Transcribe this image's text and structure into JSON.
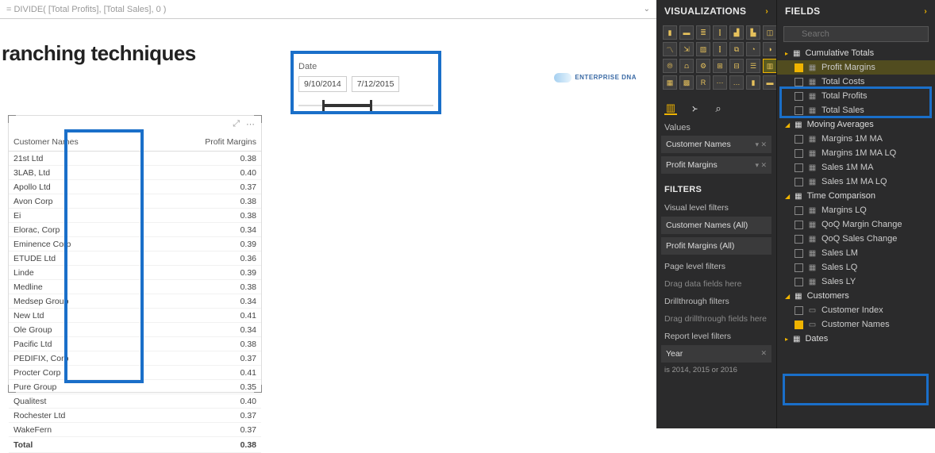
{
  "formula": "= DIVIDE( [Total Profits], [Total Sales], 0 )",
  "report_title": "ranching techniques",
  "date_slicer": {
    "label": "Date",
    "from": "9/10/2014",
    "to": "7/12/2015"
  },
  "logo_text": "ENTERPRISE DNA",
  "table": {
    "headers": [
      "Customer Names",
      "Profit Margins"
    ],
    "rows": [
      [
        "21st Ltd",
        "0.38"
      ],
      [
        "3LAB, Ltd",
        "0.40"
      ],
      [
        "Apollo Ltd",
        "0.37"
      ],
      [
        "Avon Corp",
        "0.38"
      ],
      [
        "Ei",
        "0.38"
      ],
      [
        "Elorac, Corp",
        "0.34"
      ],
      [
        "Eminence Corp",
        "0.39"
      ],
      [
        "ETUDE Ltd",
        "0.36"
      ],
      [
        "Linde",
        "0.39"
      ],
      [
        "Medline",
        "0.38"
      ],
      [
        "Medsep Group",
        "0.34"
      ],
      [
        "New Ltd",
        "0.41"
      ],
      [
        "Ole Group",
        "0.34"
      ],
      [
        "Pacific Ltd",
        "0.38"
      ],
      [
        "PEDIFIX, Corp",
        "0.37"
      ],
      [
        "Procter Corp",
        "0.41"
      ],
      [
        "Pure Group",
        "0.35"
      ],
      [
        "Qualitest",
        "0.40"
      ],
      [
        "Rochester Ltd",
        "0.37"
      ],
      [
        "WakeFern",
        "0.37"
      ]
    ],
    "total_label": "Total",
    "total_value": "0.38"
  },
  "viz": {
    "header": "VISUALIZATIONS",
    "values_label": "Values",
    "wells": [
      "Customer Names",
      "Profit Margins"
    ],
    "filters_header": "FILTERS",
    "visual_filters_label": "Visual level filters",
    "vf_wells": [
      "Customer Names (All)",
      "Profit Margins (All)"
    ],
    "page_filters_label": "Page level filters",
    "page_drop": "Drag data fields here",
    "drill_label": "Drillthrough filters",
    "drill_drop": "Drag drillthrough fields here",
    "report_filters_label": "Report level filters",
    "year_well": "Year",
    "year_sub": "is 2014, 2015 or 2016"
  },
  "fields": {
    "header": "FIELDS",
    "search_placeholder": "Search",
    "groups": [
      {
        "name": "Cumulative Totals",
        "open": false,
        "items": []
      },
      {
        "name": "",
        "open": true,
        "items": [
          {
            "label": "Profit Margins",
            "checked": true,
            "ico": "▦",
            "sel": true
          },
          {
            "label": "Total Costs",
            "checked": false,
            "ico": "▦"
          },
          {
            "label": "Total Profits",
            "checked": false,
            "ico": "▦"
          },
          {
            "label": "Total Sales",
            "checked": false,
            "ico": "▦"
          }
        ]
      },
      {
        "name": "Moving Averages",
        "open": true,
        "items": [
          {
            "label": "Margins 1M MA",
            "checked": false,
            "ico": "▦"
          },
          {
            "label": "Margins 1M MA LQ",
            "checked": false,
            "ico": "▦"
          },
          {
            "label": "Sales 1M MA",
            "checked": false,
            "ico": "▦"
          },
          {
            "label": "Sales 1M MA LQ",
            "checked": false,
            "ico": "▦"
          }
        ]
      },
      {
        "name": "Time Comparison",
        "open": true,
        "items": [
          {
            "label": "Margins LQ",
            "checked": false,
            "ico": "▦"
          },
          {
            "label": "QoQ Margin Change",
            "checked": false,
            "ico": "▦"
          },
          {
            "label": "QoQ Sales Change",
            "checked": false,
            "ico": "▦"
          },
          {
            "label": "Sales LM",
            "checked": false,
            "ico": "▦"
          },
          {
            "label": "Sales LQ",
            "checked": false,
            "ico": "▦"
          },
          {
            "label": "Sales LY",
            "checked": false,
            "ico": "▦"
          }
        ]
      },
      {
        "name": "Customers",
        "open": true,
        "items": [
          {
            "label": "Customer Index",
            "checked": false,
            "ico": "▭"
          },
          {
            "label": "Customer Names",
            "checked": true,
            "ico": "▭"
          }
        ]
      },
      {
        "name": "Dates",
        "open": false,
        "items": []
      }
    ]
  }
}
